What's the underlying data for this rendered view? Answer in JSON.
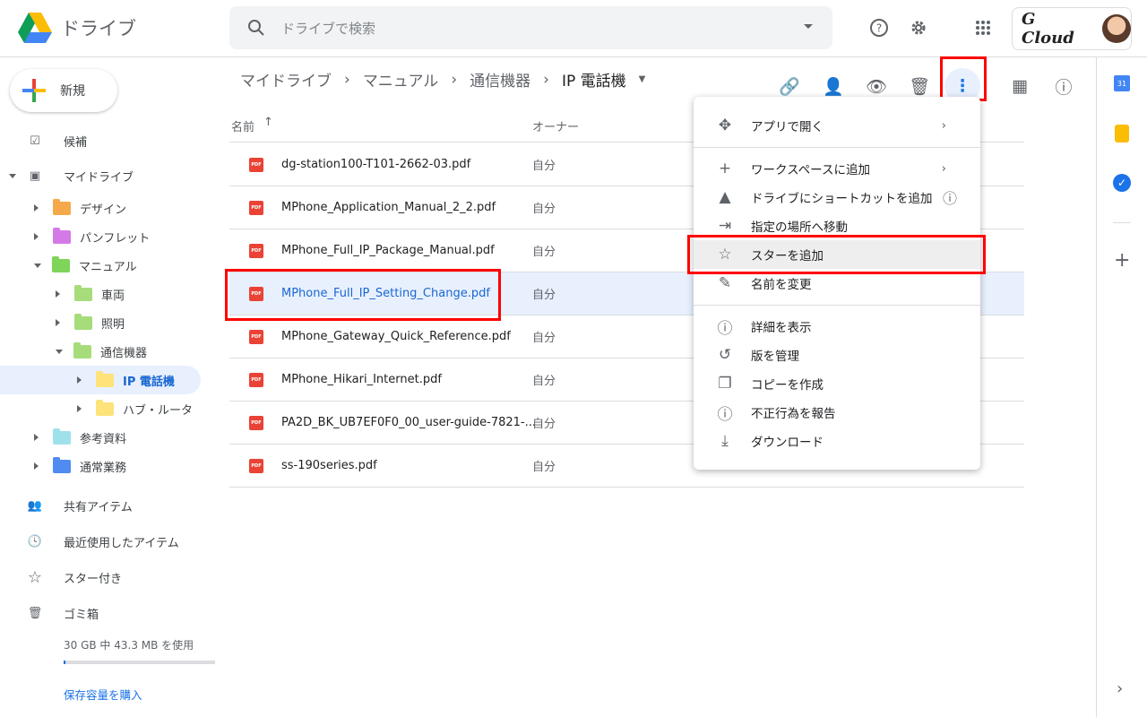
{
  "app": {
    "title": "ドライブ"
  },
  "search": {
    "placeholder": "ドライブで検索"
  },
  "account": {
    "brand": "G Cloud"
  },
  "sidebar": {
    "new_label": "新規",
    "priority": "候補",
    "my_drive": "マイドライブ",
    "tree": [
      {
        "label": "デザイン",
        "color": "#f6a94a",
        "level": 1,
        "open": false
      },
      {
        "label": "パンフレット",
        "color": "#d47ae6",
        "level": 1,
        "open": false
      },
      {
        "label": "マニュアル",
        "color": "#7fd45a",
        "level": 1,
        "open": true
      },
      {
        "label": "車両",
        "color": "#a6dc7a",
        "level": 2,
        "open": false
      },
      {
        "label": "照明",
        "color": "#a6dc7a",
        "level": 2,
        "open": false
      },
      {
        "label": "通信機器",
        "color": "#a6dc7a",
        "level": 2,
        "open": true
      },
      {
        "label": "IP 電話機",
        "color": "#fde37a",
        "level": 3,
        "open": false,
        "selected": true
      },
      {
        "label": "ハブ・ルータ",
        "color": "#fde37a",
        "level": 3,
        "open": false
      },
      {
        "label": "参考資料",
        "color": "#9fe1ea",
        "level": 1,
        "open": false
      },
      {
        "label": "通常業務",
        "color": "#4f8bf0",
        "level": 1,
        "open": false
      }
    ],
    "shared": "共有アイテム",
    "recent": "最近使用したアイテム",
    "starred": "スター付き",
    "trash": "ゴミ箱",
    "storage_text": "30 GB 中 43.3 MB を使用",
    "storage_used_percent": 0.14,
    "buy_storage": "保存容量を購入"
  },
  "breadcrumb": [
    "マイドライブ",
    "マニュアル",
    "通信機器",
    "IP 電話機"
  ],
  "table": {
    "col_name": "名前",
    "col_owner": "オーナー",
    "rows": [
      {
        "name": "dg-station100-T101-2662-03.pdf",
        "owner": "自分"
      },
      {
        "name": "MPhone_Application_Manual_2_2.pdf",
        "owner": "自分"
      },
      {
        "name": "MPhone_Full_IP_Package_Manual.pdf",
        "owner": "自分"
      },
      {
        "name": "MPhone_Full_IP_Setting_Change.pdf",
        "owner": "自分",
        "selected": true
      },
      {
        "name": "MPhone_Gateway_Quick_Reference.pdf",
        "owner": "自分"
      },
      {
        "name": "MPhone_Hikari_Internet.pdf",
        "owner": "自分"
      },
      {
        "name": "PA2D_BK_UB7EF0F0_00_user-guide-7821-...",
        "owner": "自分"
      },
      {
        "name": "ss-190series.pdf",
        "owner": "自分"
      }
    ]
  },
  "context_menu": [
    {
      "label": "アプリで開く",
      "icon": "move-arrows-icon",
      "submenu": true
    },
    {
      "label": "ワークスペースに追加",
      "icon": "plus-icon",
      "submenu": true
    },
    {
      "label": "ドライブにショートカットを追加",
      "icon": "drive-add-icon",
      "help": true
    },
    {
      "label": "指定の場所へ移動",
      "icon": "move-folder-icon"
    },
    {
      "label": "スターを追加",
      "icon": "star-icon",
      "hovered": true
    },
    {
      "label": "名前を変更",
      "icon": "pencil-icon"
    },
    {
      "label": "詳細を表示",
      "icon": "info-icon"
    },
    {
      "label": "版を管理",
      "icon": "history-icon"
    },
    {
      "label": "コピーを作成",
      "icon": "copy-icon"
    },
    {
      "label": "不正行為を報告",
      "icon": "report-icon"
    },
    {
      "label": "ダウンロード",
      "icon": "download-icon"
    }
  ],
  "colors": {
    "accent": "#1a73e8",
    "highlight": "#ff0000",
    "selected_bg": "#e8f0fe"
  }
}
